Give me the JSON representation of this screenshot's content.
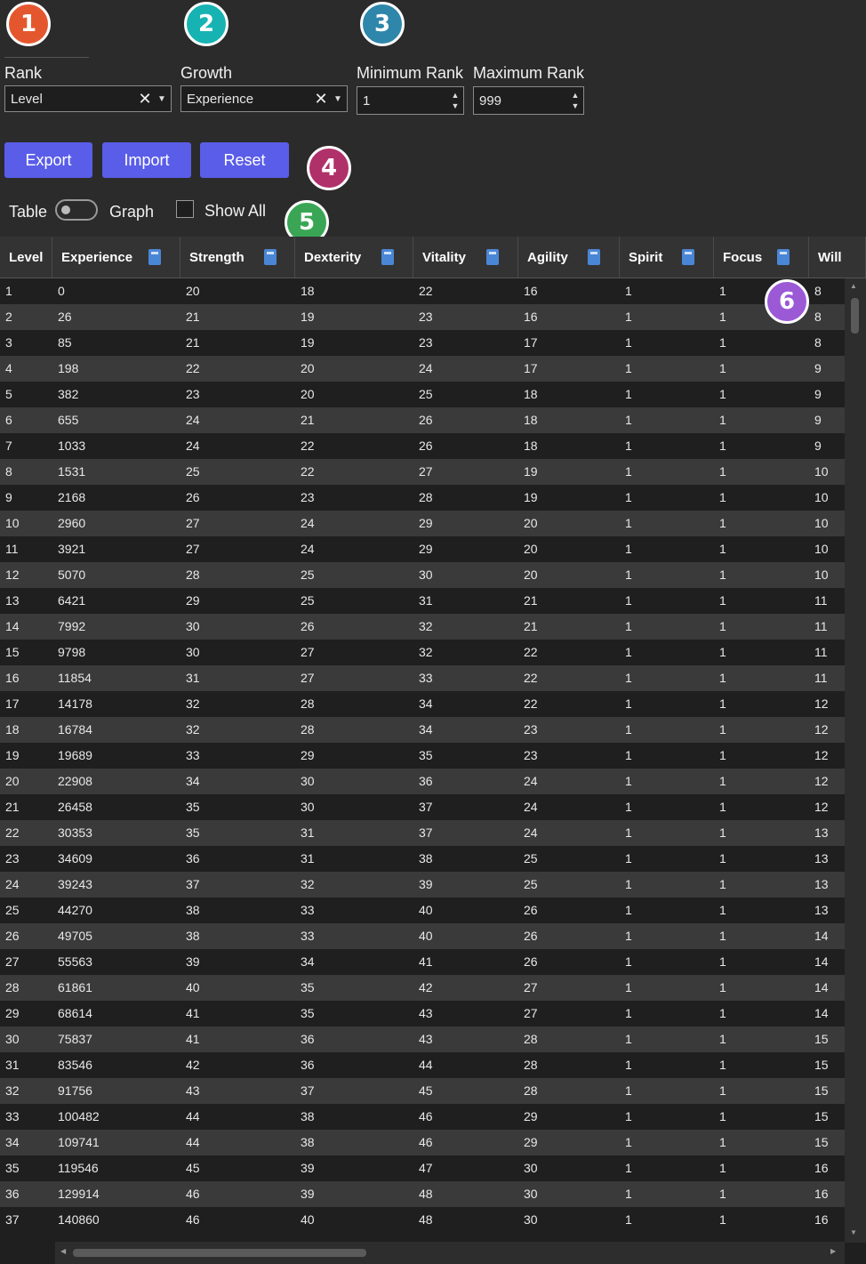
{
  "badges": [
    "1",
    "2",
    "3",
    "4",
    "5",
    "6"
  ],
  "badge_colors": {
    "b1": "#e4572e",
    "b2": "#17b3b3",
    "b3": "#2e86ab",
    "b4": "#b0306a",
    "b5": "#3aa655",
    "b6": "#9b59d6"
  },
  "rank": {
    "label": "Rank",
    "value": "Level"
  },
  "growth": {
    "label": "Growth",
    "value": "Experience"
  },
  "min_rank": {
    "label": "Minimum Rank",
    "value": "1"
  },
  "max_rank": {
    "label": "Maximum Rank",
    "value": "999"
  },
  "buttons": {
    "export": "Export",
    "import": "Import",
    "reset": "Reset"
  },
  "view": {
    "table": "Table",
    "graph": "Graph",
    "show_all": "Show All"
  },
  "icons": {
    "clear": "close-icon",
    "dropdown": "chevron-down-icon",
    "calculator": "calculator-icon"
  },
  "accent": "#5a5de8",
  "columns": [
    "Level",
    "Experience",
    "Strength",
    "Dexterity",
    "Vitality",
    "Agility",
    "Spirit",
    "Focus",
    "Will"
  ],
  "rows": [
    [
      "1",
      "0",
      "20",
      "18",
      "22",
      "16",
      "1",
      "1",
      "8"
    ],
    [
      "2",
      "26",
      "21",
      "19",
      "23",
      "16",
      "1",
      "1",
      "8"
    ],
    [
      "3",
      "85",
      "21",
      "19",
      "23",
      "17",
      "1",
      "1",
      "8"
    ],
    [
      "4",
      "198",
      "22",
      "20",
      "24",
      "17",
      "1",
      "1",
      "9"
    ],
    [
      "5",
      "382",
      "23",
      "20",
      "25",
      "18",
      "1",
      "1",
      "9"
    ],
    [
      "6",
      "655",
      "24",
      "21",
      "26",
      "18",
      "1",
      "1",
      "9"
    ],
    [
      "7",
      "1033",
      "24",
      "22",
      "26",
      "18",
      "1",
      "1",
      "9"
    ],
    [
      "8",
      "1531",
      "25",
      "22",
      "27",
      "19",
      "1",
      "1",
      "10"
    ],
    [
      "9",
      "2168",
      "26",
      "23",
      "28",
      "19",
      "1",
      "1",
      "10"
    ],
    [
      "10",
      "2960",
      "27",
      "24",
      "29",
      "20",
      "1",
      "1",
      "10"
    ],
    [
      "11",
      "3921",
      "27",
      "24",
      "29",
      "20",
      "1",
      "1",
      "10"
    ],
    [
      "12",
      "5070",
      "28",
      "25",
      "30",
      "20",
      "1",
      "1",
      "10"
    ],
    [
      "13",
      "6421",
      "29",
      "25",
      "31",
      "21",
      "1",
      "1",
      "11"
    ],
    [
      "14",
      "7992",
      "30",
      "26",
      "32",
      "21",
      "1",
      "1",
      "11"
    ],
    [
      "15",
      "9798",
      "30",
      "27",
      "32",
      "22",
      "1",
      "1",
      "11"
    ],
    [
      "16",
      "11854",
      "31",
      "27",
      "33",
      "22",
      "1",
      "1",
      "11"
    ],
    [
      "17",
      "14178",
      "32",
      "28",
      "34",
      "22",
      "1",
      "1",
      "12"
    ],
    [
      "18",
      "16784",
      "32",
      "28",
      "34",
      "23",
      "1",
      "1",
      "12"
    ],
    [
      "19",
      "19689",
      "33",
      "29",
      "35",
      "23",
      "1",
      "1",
      "12"
    ],
    [
      "20",
      "22908",
      "34",
      "30",
      "36",
      "24",
      "1",
      "1",
      "12"
    ],
    [
      "21",
      "26458",
      "35",
      "30",
      "37",
      "24",
      "1",
      "1",
      "12"
    ],
    [
      "22",
      "30353",
      "35",
      "31",
      "37",
      "24",
      "1",
      "1",
      "13"
    ],
    [
      "23",
      "34609",
      "36",
      "31",
      "38",
      "25",
      "1",
      "1",
      "13"
    ],
    [
      "24",
      "39243",
      "37",
      "32",
      "39",
      "25",
      "1",
      "1",
      "13"
    ],
    [
      "25",
      "44270",
      "38",
      "33",
      "40",
      "26",
      "1",
      "1",
      "13"
    ],
    [
      "26",
      "49705",
      "38",
      "33",
      "40",
      "26",
      "1",
      "1",
      "14"
    ],
    [
      "27",
      "55563",
      "39",
      "34",
      "41",
      "26",
      "1",
      "1",
      "14"
    ],
    [
      "28",
      "61861",
      "40",
      "35",
      "42",
      "27",
      "1",
      "1",
      "14"
    ],
    [
      "29",
      "68614",
      "41",
      "35",
      "43",
      "27",
      "1",
      "1",
      "14"
    ],
    [
      "30",
      "75837",
      "41",
      "36",
      "43",
      "28",
      "1",
      "1",
      "15"
    ],
    [
      "31",
      "83546",
      "42",
      "36",
      "44",
      "28",
      "1",
      "1",
      "15"
    ],
    [
      "32",
      "91756",
      "43",
      "37",
      "45",
      "28",
      "1",
      "1",
      "15"
    ],
    [
      "33",
      "100482",
      "44",
      "38",
      "46",
      "29",
      "1",
      "1",
      "15"
    ],
    [
      "34",
      "109741",
      "44",
      "38",
      "46",
      "29",
      "1",
      "1",
      "15"
    ],
    [
      "35",
      "119546",
      "45",
      "39",
      "47",
      "30",
      "1",
      "1",
      "16"
    ],
    [
      "36",
      "129914",
      "46",
      "39",
      "48",
      "30",
      "1",
      "1",
      "16"
    ],
    [
      "37",
      "140860",
      "46",
      "40",
      "48",
      "30",
      "1",
      "1",
      "16"
    ]
  ]
}
